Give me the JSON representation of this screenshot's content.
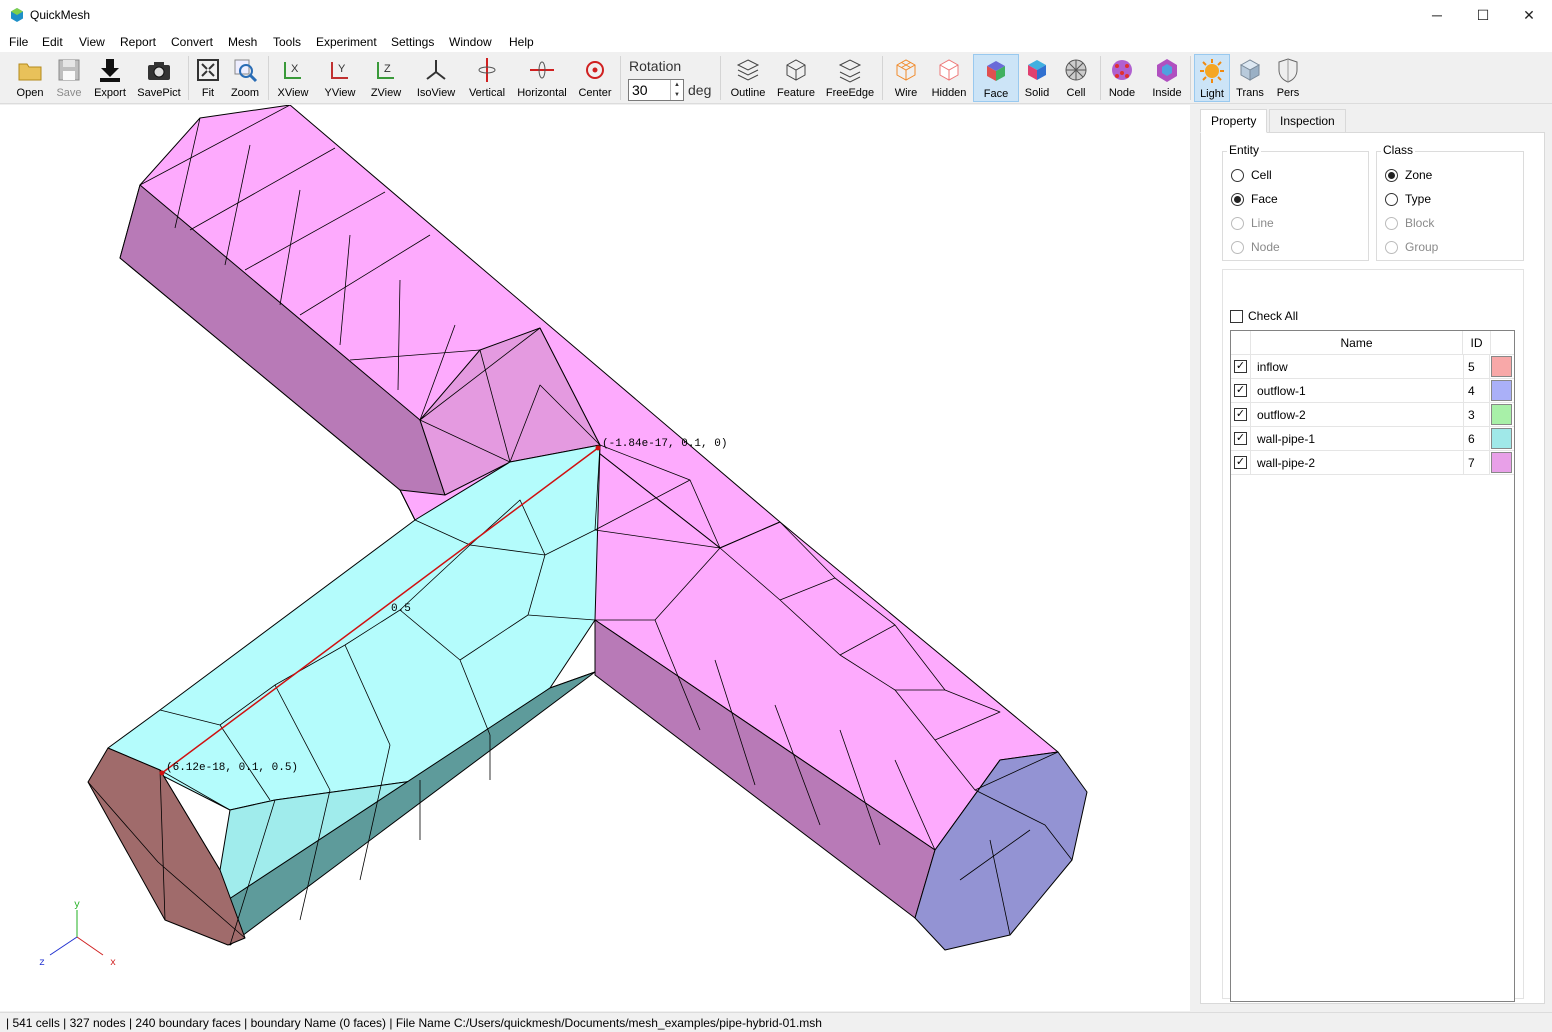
{
  "window": {
    "title": "QuickMesh",
    "minimize": "─",
    "maximize": "☐",
    "close": "✕"
  },
  "menu": [
    "File",
    "Edit",
    "View",
    "Report",
    "Convert",
    "Mesh",
    "Tools",
    "Experiment",
    "Settings",
    "Window",
    "Help"
  ],
  "toolbar": {
    "buttons": [
      "Open",
      "Save",
      "Export",
      "SavePict",
      "Fit",
      "Zoom",
      "XView",
      "YView",
      "ZView",
      "IsoView",
      "Vertical",
      "Horizontal",
      "Center",
      "Outline",
      "Feature",
      "FreeEdge",
      "Wire",
      "Hidden",
      "Face",
      "Solid",
      "Cell",
      "Node",
      "Inside",
      "Light",
      "Trans",
      "Pers"
    ],
    "active": [
      "Face",
      "Light"
    ],
    "disabled": [
      "Save"
    ],
    "rotation_label": "Rotation",
    "rotation_value": "30",
    "rotation_unit": "deg"
  },
  "viewport": {
    "annotations": {
      "point_a": "(-1.84e-17, 0.1, 0)",
      "point_b": "(6.12e-18, 0.1, 0.5)",
      "distance": "0.5"
    },
    "axes": {
      "x": "x",
      "y": "y",
      "z": "z"
    }
  },
  "panel": {
    "tabs": [
      "Property",
      "Inspection"
    ],
    "entity": {
      "title": "Entity",
      "options": [
        {
          "label": "Cell",
          "checked": false,
          "enabled": true
        },
        {
          "label": "Face",
          "checked": true,
          "enabled": true
        },
        {
          "label": "Line",
          "checked": false,
          "enabled": false
        },
        {
          "label": "Node",
          "checked": false,
          "enabled": false
        }
      ]
    },
    "class": {
      "title": "Class",
      "options": [
        {
          "label": "Zone",
          "checked": true,
          "enabled": true
        },
        {
          "label": "Type",
          "checked": false,
          "enabled": true
        },
        {
          "label": "Block",
          "checked": false,
          "enabled": false
        },
        {
          "label": "Group",
          "checked": false,
          "enabled": false
        }
      ]
    },
    "check_all_label": "Check All",
    "table": {
      "headers": [
        "Name",
        "ID"
      ],
      "rows": [
        {
          "name": "inflow",
          "id": "5",
          "color": "#f8a8a8",
          "checked": true
        },
        {
          "name": "outflow-1",
          "id": "4",
          "color": "#aab0f8",
          "checked": true
        },
        {
          "name": "outflow-2",
          "id": "3",
          "color": "#a8f0a8",
          "checked": true
        },
        {
          "name": "wall-pipe-1",
          "id": "6",
          "color": "#a0e8e8",
          "checked": true
        },
        {
          "name": "wall-pipe-2",
          "id": "7",
          "color": "#e8a0e8",
          "checked": true
        }
      ]
    }
  },
  "status": "| 541 cells | 327 nodes | 240 boundary faces |  boundary Name  (0 faces) | File Name C:/Users/quickmesh/Documents/mesh_examples/pipe-hybrid-01.msh"
}
